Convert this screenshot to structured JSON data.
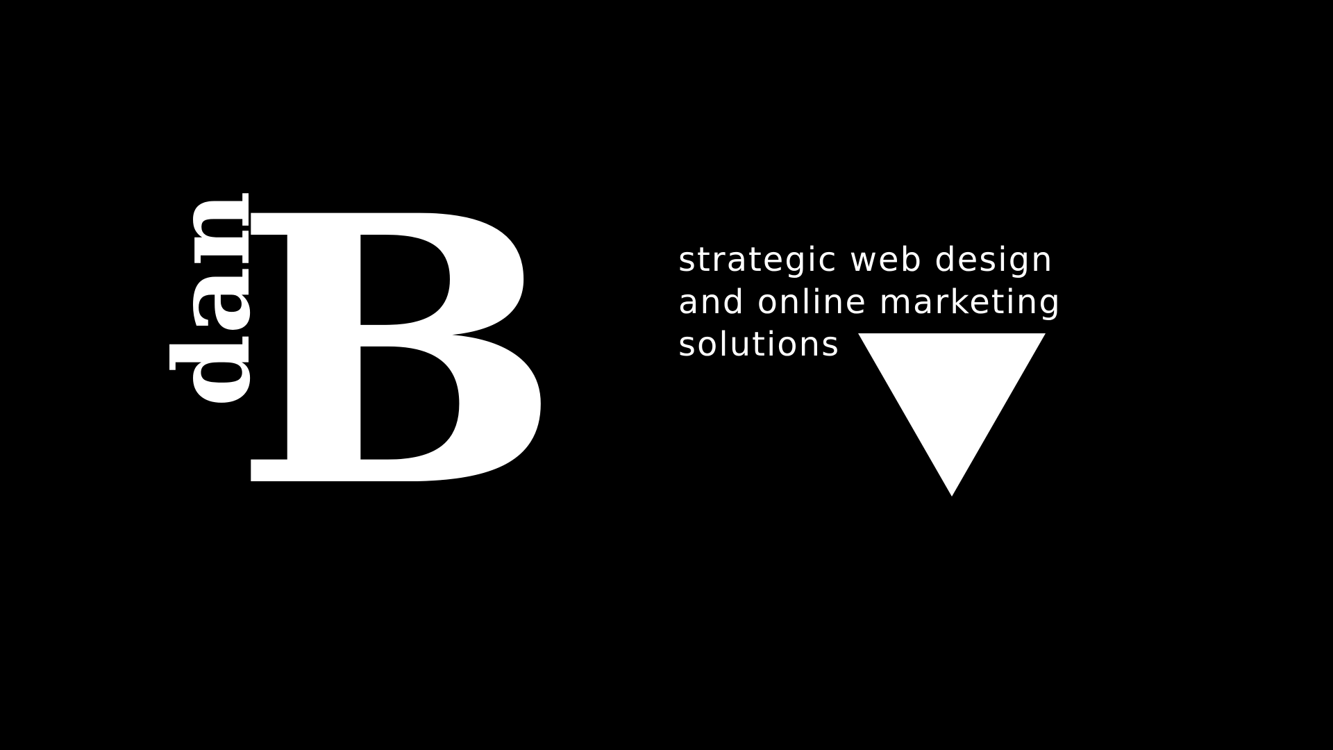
{
  "logo": {
    "big_letter": "B",
    "small_text": "dan"
  },
  "tagline": {
    "line1": "strategic web design",
    "line2": "and online marketing",
    "line3": "solutions"
  },
  "icons": {
    "scroll_indicator": "triangle-down-icon"
  },
  "colors": {
    "background": "#000000",
    "foreground": "#ffffff"
  }
}
